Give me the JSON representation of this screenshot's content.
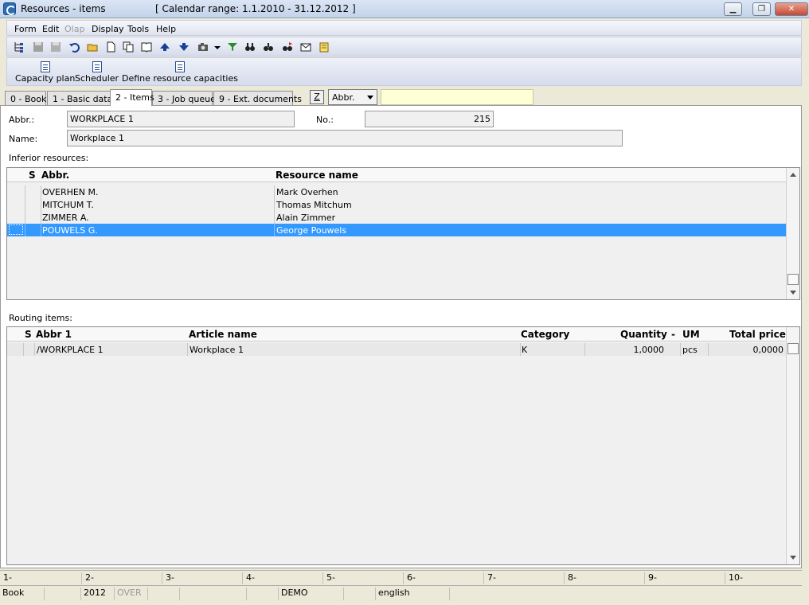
{
  "window": {
    "title": "Resources - items",
    "calendar_range": "[ Calendar range: 1.1.2010 - 31.12.2012 ]",
    "minimize": "▁",
    "restore": "❐",
    "close": "✕"
  },
  "menu": {
    "items": [
      "Form",
      "Edit",
      "Olap",
      "Display",
      "Tools",
      "Help"
    ]
  },
  "toolbar": {
    "icons": [
      "tree-icon",
      "save-icon",
      "save-as-icon",
      "undo-icon",
      "open-folder-icon",
      "new-document-icon",
      "copy-icon",
      "book-icon",
      "arrow-up-icon",
      "arrow-down-icon",
      "camera-icon",
      "dropdown-arrow-icon",
      "filter-icon",
      "binoculars-icon",
      "find-next-icon",
      "find-replace-icon",
      "mail-icon",
      "notes-icon"
    ]
  },
  "actions": [
    {
      "label": "Capacity plan",
      "icon": "document-icon"
    },
    {
      "label": "Scheduler",
      "icon": "document-icon"
    },
    {
      "label": "Define resource capacities",
      "icon": "document-icon"
    }
  ],
  "tabs": [
    "0 - Book",
    "1 - Basic data",
    "2 - Items",
    "3 - Job queue",
    "9 - Ext. documents"
  ],
  "active_tab": "2 - Items",
  "search": {
    "z_button": "Z",
    "combo_value": "Abbr.",
    "text": ""
  },
  "form": {
    "abbr_label": "Abbr.:",
    "abbr_value": "WORKPLACE 1",
    "no_label": "No.:",
    "no_value": "215",
    "name_label": "Name:",
    "name_value": "Workplace 1"
  },
  "inferior": {
    "title": "Inferior resources:",
    "columns": [
      "S",
      "Abbr.",
      "Resource name"
    ],
    "rows": [
      {
        "abbr": "OVERHEN M.",
        "name": "Mark Overhen",
        "selected": false
      },
      {
        "abbr": "MITCHUM T.",
        "name": "Thomas Mitchum",
        "selected": false
      },
      {
        "abbr": "ZIMMER A.",
        "name": "Alain Zimmer",
        "selected": false
      },
      {
        "abbr": "POUWELS G.",
        "name": "George Pouwels",
        "selected": true
      }
    ]
  },
  "routing": {
    "title": "Routing items:",
    "columns": [
      "S",
      "Abbr 1",
      "Article name",
      "Category",
      "Quantity",
      "-",
      "UM",
      "Total price"
    ],
    "rows": [
      {
        "s": "",
        "abbr1": "/WORKPLACE 1",
        "article": "Workplace 1",
        "category": "K",
        "quantity": "1,0000",
        "um": "pcs",
        "total": "0,0000"
      }
    ]
  },
  "function_keys": [
    "1-",
    "2-",
    "3-",
    "4-",
    "5-",
    "6-",
    "7-",
    "8-",
    "9-",
    "10-"
  ],
  "status": {
    "cells": [
      {
        "text": "Book",
        "disabled": false
      },
      {
        "text": "",
        "disabled": false
      },
      {
        "text": "2012",
        "disabled": false
      },
      {
        "text": "OVER",
        "disabled": true
      },
      {
        "text": "",
        "disabled": false
      },
      {
        "text": "",
        "disabled": false
      },
      {
        "text": "",
        "disabled": false
      },
      {
        "text": "DEMO",
        "disabled": false
      },
      {
        "text": "",
        "disabled": false
      },
      {
        "text": "english",
        "disabled": false
      }
    ]
  },
  "colors": {
    "selection": "#3399ff",
    "search_bg": "#ffffd5",
    "accent": "#2d6db5"
  }
}
